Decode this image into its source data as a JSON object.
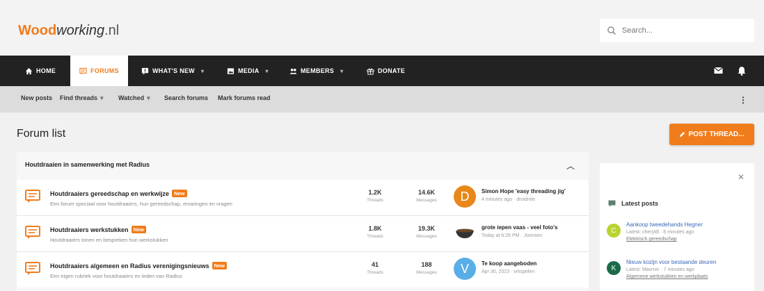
{
  "header": {
    "logo_part1": "Wood",
    "logo_part2": "working",
    "logo_part3": ".nl",
    "search_placeholder": "Search..."
  },
  "nav": [
    {
      "label": "HOME",
      "icon": "home-icon",
      "active": false
    },
    {
      "label": "FORUMS",
      "icon": "forums-icon",
      "active": true
    },
    {
      "label": "WHAT'S NEW",
      "icon": "whats-new-icon",
      "active": false,
      "dropdown": true
    },
    {
      "label": "MEDIA",
      "icon": "media-icon",
      "active": false,
      "dropdown": true
    },
    {
      "label": "MEMBERS",
      "icon": "members-icon",
      "active": false,
      "dropdown": true
    },
    {
      "label": "DONATE",
      "icon": "gift-icon",
      "active": false
    }
  ],
  "subnav": [
    {
      "label": "New posts"
    },
    {
      "label": "Find threads",
      "dropdown": true
    },
    {
      "label": "Watched",
      "dropdown": true
    },
    {
      "label": "Search forums"
    },
    {
      "label": "Mark forums read"
    }
  ],
  "page": {
    "title": "Forum list",
    "post_thread_label": "POST THREAD..."
  },
  "category": {
    "title": "Houtdraaien in samenwerking met Radius",
    "nodes": [
      {
        "title": "Houtdraaiers gereedschap en werkwijze",
        "badge": "New",
        "description": "Een forum speciaal voor houtdraaiers, hun gereedschap, ervaringen en vragen",
        "threads": "1.2K",
        "threads_label": "Threads",
        "messages": "14.6K",
        "messages_label": "Messages",
        "last_avatar": "D",
        "last_avatar_color": "#e8871a",
        "last_title": "Simon Hope 'easy threading jig'",
        "last_meta": "4 minutes ago · droidnite"
      },
      {
        "title": "Houtdraaiers werkstukken",
        "badge": "New",
        "description": "Houtdraaiers tonen en bespreken hun werkstukken",
        "threads": "1.8K",
        "threads_label": "Threads",
        "messages": "19.3K",
        "messages_label": "Messages",
        "last_avatar": "",
        "last_avatar_color": "#ffffff",
        "last_title": "grote iepen vaas - veel foto's",
        "last_meta": "Today at 6:26 PM · Joonsen"
      },
      {
        "title": "Houtdraaiers algemeen en Radius verenigingsnieuws",
        "badge": "New",
        "description": "Een eigen rubriek voor houtdraaiers en leden van Radius",
        "threads": "41",
        "threads_label": "Threads",
        "messages": "188",
        "messages_label": "Messages",
        "last_avatar": "V",
        "last_avatar_color": "#5aaee8",
        "last_title": "Te koop aangeboden",
        "last_meta": "Apr 30, 2023 · vrkspelen"
      }
    ]
  },
  "sidebar": {
    "heading": "Latest posts",
    "items": [
      {
        "avatar": "C",
        "avatar_color": "#b8d430",
        "title": "Aankoop tweedehands Hegner",
        "meta": "Latest: cheryldl · 8 minutes ago",
        "forum": "Elektrisch gereedschap"
      },
      {
        "avatar": "K",
        "avatar_color": "#1a6b4a",
        "title": "Nieuw kozijn voor bestaande deuren",
        "meta": "Latest: Mavrnic · 7 minutes ago",
        "forum": "Algemene werkstukken en werkplaats"
      }
    ]
  }
}
